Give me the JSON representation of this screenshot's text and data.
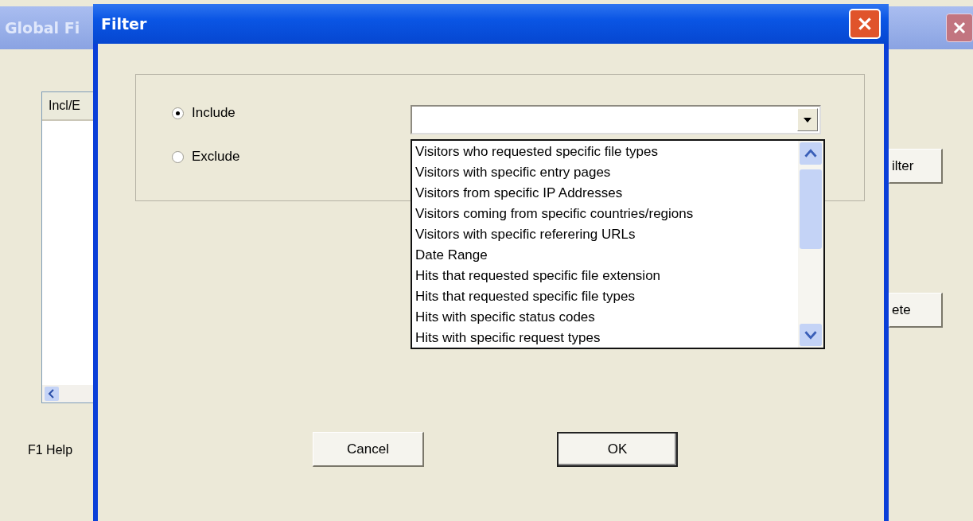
{
  "background_window": {
    "title": "Global Fi",
    "list_header": "Incl/E",
    "buttons": [
      "ilter",
      "ete"
    ],
    "help": "F1 Help"
  },
  "dialog": {
    "title": "Filter",
    "options": [
      {
        "label": "Include",
        "selected": true
      },
      {
        "label": "Exclude",
        "selected": false
      }
    ],
    "dropdown": {
      "items": [
        {
          "label": "Visitors who requested specific file types",
          "selected": false
        },
        {
          "label": "Visitors with specific entry pages",
          "selected": false
        },
        {
          "label": "Visitors from specific IP Addresses",
          "selected": false
        },
        {
          "label": "Visitors coming from specific countries/regions",
          "selected": false
        },
        {
          "label": "Visitors with specific referering URLs",
          "selected": false
        },
        {
          "label": "Date Range",
          "selected": false
        },
        {
          "label": "Hits that requested specific file extension",
          "selected": false
        },
        {
          "label": "Hits that requested specific file types",
          "selected": false
        },
        {
          "label": "Hits with specific status codes",
          "selected": false
        },
        {
          "label": "Hits with specific request types",
          "selected": false
        }
      ]
    },
    "buttons": [
      {
        "label": "Cancel",
        "default": false
      },
      {
        "label": "OK",
        "default": true
      }
    ]
  }
}
